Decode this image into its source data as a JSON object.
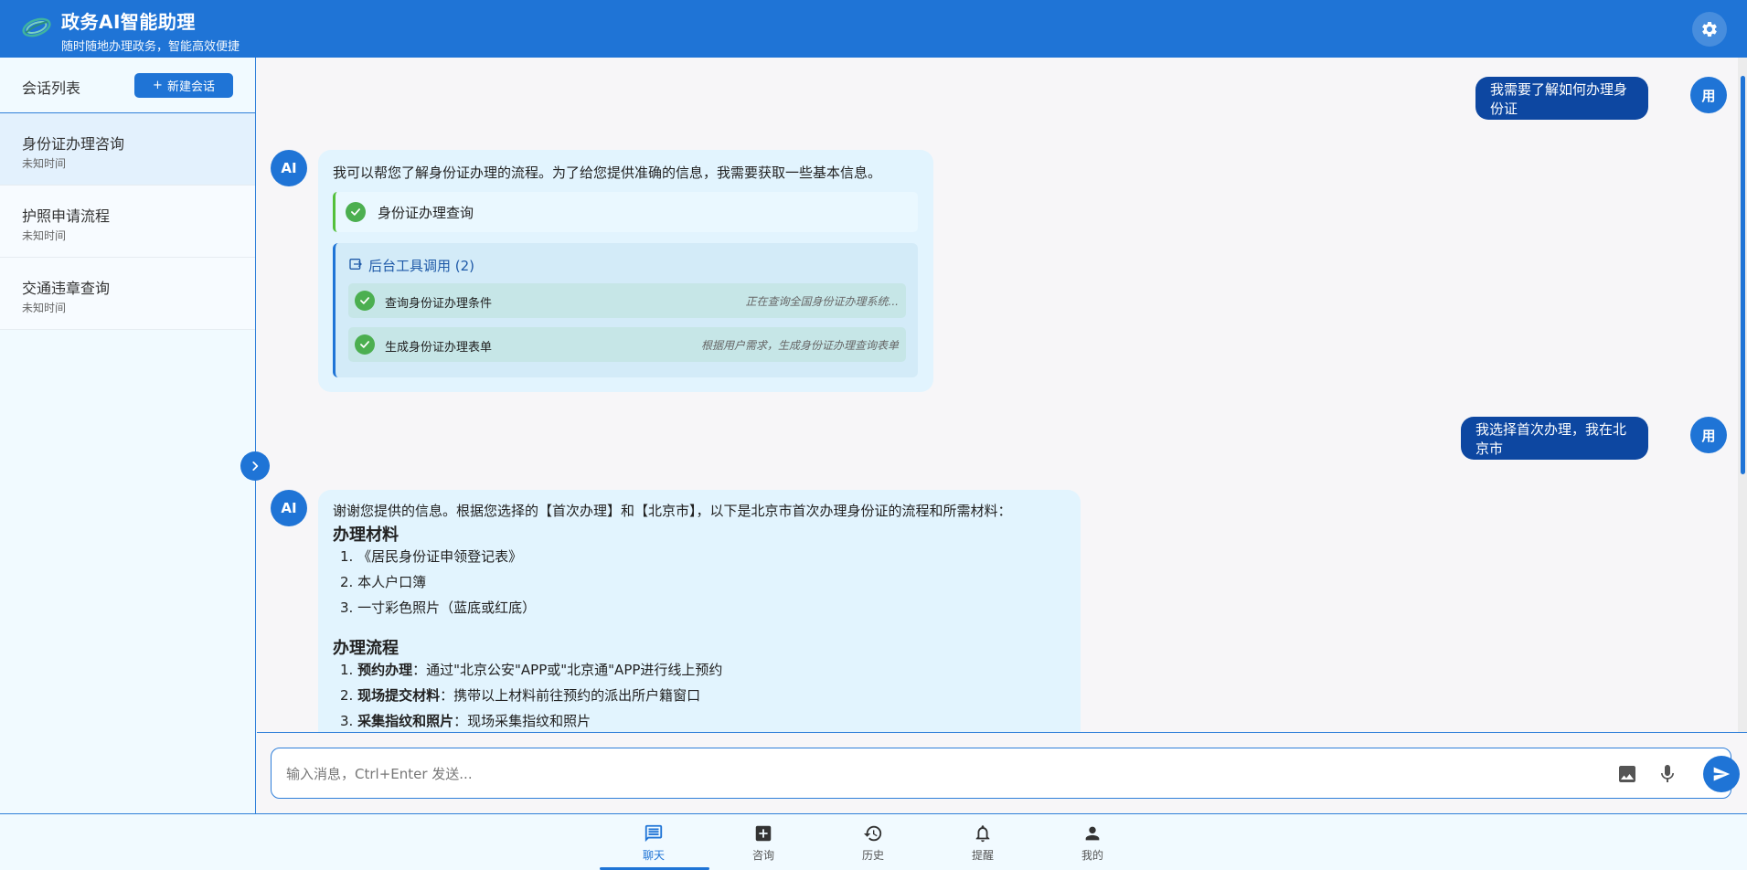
{
  "header": {
    "title": "政务AI智能助理",
    "subtitle": "随时随地办理政务，智能高效便捷",
    "logo_icon": "globe-logo-icon",
    "settings_icon": "gear-icon"
  },
  "sidebar": {
    "title": "会话列表",
    "new_chat_label": "新建会话",
    "sessions": [
      {
        "name": "身份证办理咨询",
        "time": "未知时间",
        "active": true
      },
      {
        "name": "护照申请流程",
        "time": "未知时间",
        "active": false
      },
      {
        "name": "交通违章查询",
        "time": "未知时间",
        "active": false
      }
    ]
  },
  "chat": {
    "user_avatar": "用",
    "ai_avatar": "AI",
    "messages": [
      {
        "role": "user",
        "text": "我需要了解如何办理身份证"
      },
      {
        "role": "ai",
        "text": "我可以帮您了解身份证办理的流程。为了给您提供准确的信息，我需要获取一些基本信息。",
        "checked_item": "身份证办理查询",
        "tools_title": "后台工具调用 (2)",
        "tools": [
          {
            "label": "查询身份证办理条件",
            "status": "正在查询全国身份证办理系统..."
          },
          {
            "label": "生成身份证办理表单",
            "status": "根据用户需求，生成身份证办理查询表单"
          }
        ]
      },
      {
        "role": "user",
        "text": "我选择首次办理，我在北京市"
      },
      {
        "role": "ai",
        "intro": "谢谢您提供的信息。根据您选择的【首次办理】和【北京市】，以下是北京市首次办理身份证的流程和所需材料：",
        "materials_heading": "办理材料",
        "materials": [
          "1. 《居民身份证申领登记表》",
          "2. 本人户口簿",
          "3. 一寸彩色照片（蓝底或红底）"
        ],
        "process_heading": "办理流程",
        "process": [
          {
            "num": "1.",
            "bold": "预约办理",
            "rest": "：通过\"北京公安\"APP或\"北京通\"APP进行线上预约"
          },
          {
            "num": "2.",
            "bold": "现场提交材料",
            "rest": "：携带以上材料前往预约的派出所户籍窗口"
          },
          {
            "num": "3.",
            "bold": "采集指纹和照片",
            "rest": "：现场采集指纹和照片"
          }
        ]
      }
    ]
  },
  "input": {
    "placeholder": "输入消息，Ctrl+Enter 发送...",
    "image_icon": "image-icon",
    "mic_icon": "microphone-icon",
    "send_icon": "send-icon"
  },
  "bottom_nav": [
    {
      "label": "聊天",
      "icon": "chat-icon",
      "active": true
    },
    {
      "label": "咨询",
      "icon": "add-square-icon",
      "active": false
    },
    {
      "label": "历史",
      "icon": "history-icon",
      "active": false
    },
    {
      "label": "提醒",
      "icon": "bell-icon",
      "active": false
    },
    {
      "label": "我的",
      "icon": "person-icon",
      "active": false
    }
  ],
  "colors": {
    "primary": "#1f74d6",
    "user_bubble": "#0d47a1",
    "ai_bubble": "#e2f4fe",
    "success": "#4caf50"
  }
}
